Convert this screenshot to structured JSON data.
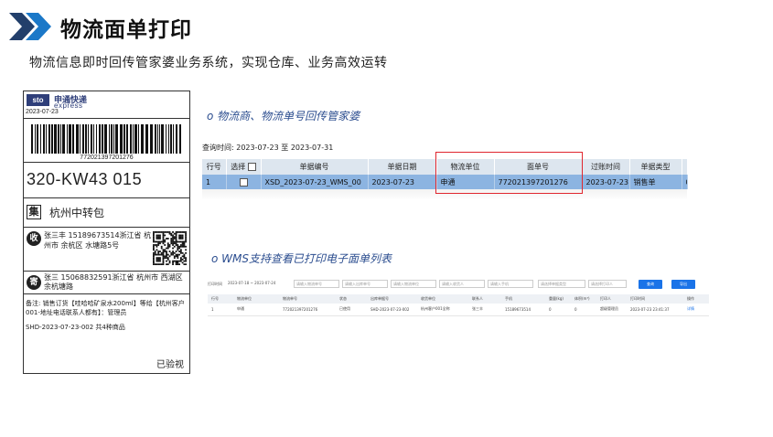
{
  "header": {
    "title": "物流面单打印",
    "subtitle": "物流信息即时回传管家婆业务系统，实现仓库、业务高效运转",
    "chevron_color": "#1b78c8"
  },
  "waybill": {
    "logo_text": "sto",
    "carrier_cn": "申通快递",
    "carrier_en": "express",
    "date": "2023-07-23",
    "tracking_number": "772021397201276",
    "sort_code": "320-KW43 015",
    "hub_tag": "集",
    "hub": "杭州中转包",
    "receiver_tag": "收",
    "receiver": "张三丰 15189673514浙江省 杭州市 余杭区 水塘路5号",
    "sender_tag": "寄",
    "sender": "张三 15068832591浙江省 杭州市 西湖区 余杭塘路",
    "note": "备注:   销售订货【哇哈哈矿泉水200ml】等给【杭州客户001-地址电话联系人都有】：管理员",
    "order_line": "SHD-2023-07-23-002 共4种商品",
    "inspected": "已验视"
  },
  "section1": {
    "heading": "o 物流商、物流单号回传管家婆",
    "query": "查询时间:  2023-07-23 至 2023-07-31",
    "columns": [
      "行号",
      "选择",
      "单据编号",
      "单据日期",
      "物流单位",
      "面单号",
      "过账时间",
      "单据类型",
      ""
    ],
    "row": {
      "no": "1",
      "bill_no": "XSD_2023-07-23_WMS_00",
      "bill_date": "2023-07-23",
      "carrier": "申通",
      "waybill_no": "772021397201276",
      "post_time": "2023-07-23",
      "bill_type": "销售单",
      "extra": "0"
    }
  },
  "section2": {
    "heading": "o WMS支持查看已打印电子面单列表",
    "filter": {
      "label": "打印时间",
      "date_range": "2023-07-18 ~ 2023-07-24",
      "placeholders": [
        "请输入物流单号",
        "请输入出库单号",
        "请输入物流单位",
        "请输入收货人",
        "请输入手机",
        "请选择单据类型",
        "请选择打印人"
      ],
      "search_label": "查询",
      "export_label": "导出"
    },
    "columns": [
      "行号",
      "物流单位",
      "物流单号",
      "状态",
      "出库单据号",
      "收货单位",
      "联系人",
      "手机",
      "重量(kg)",
      "体积(m³)",
      "打印人",
      "打印时间",
      "操作"
    ],
    "row": [
      "1",
      "申通",
      "772021397201276",
      "已使用",
      "SHD-2023-07-23-002",
      "杭州客户001全称",
      "张三丰",
      "15189673514",
      "0",
      "0",
      "超级管理员",
      "2023-07-23 23:41:37",
      "详情"
    ]
  }
}
